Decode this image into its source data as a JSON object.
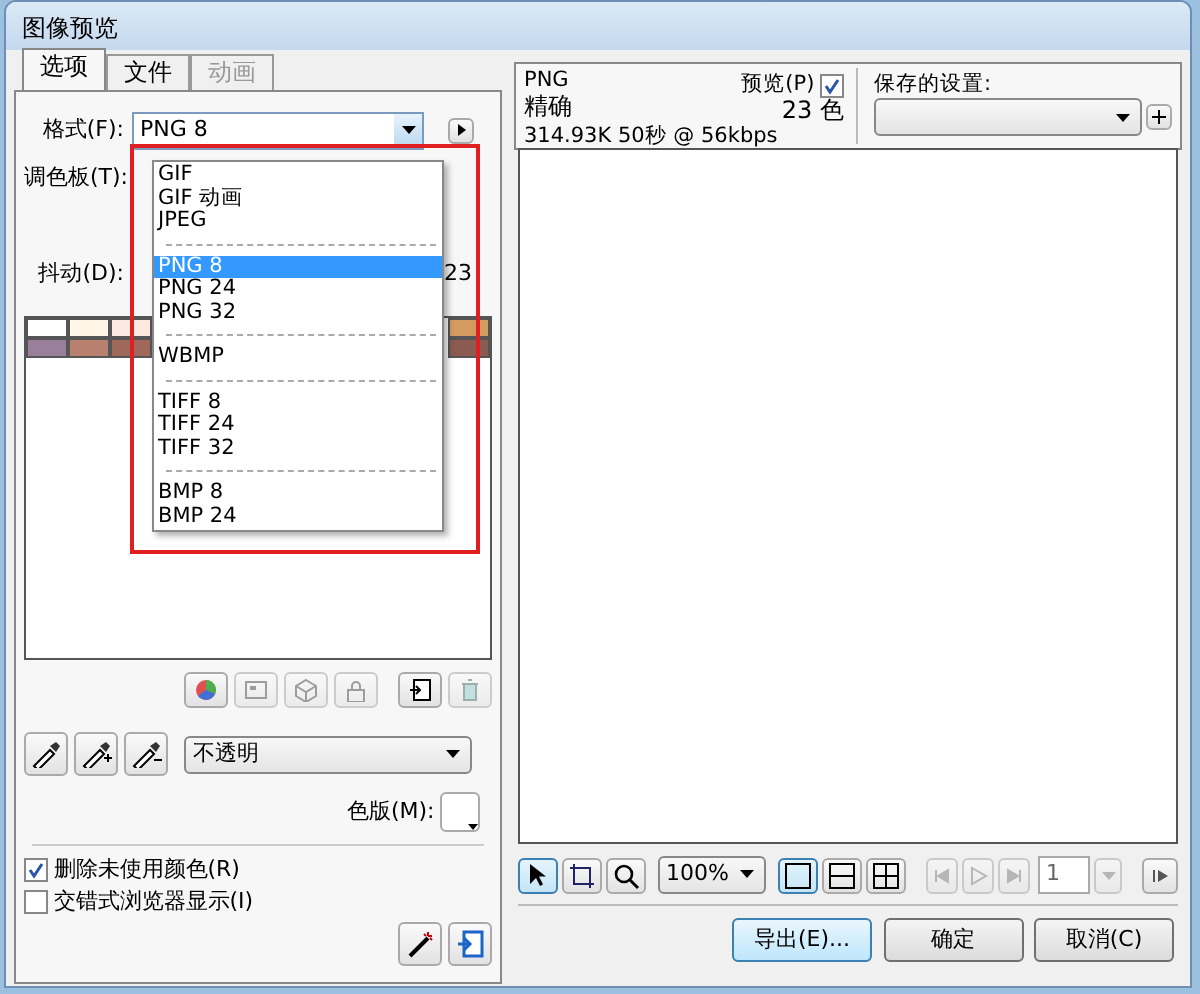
{
  "window": {
    "title": "图像预览"
  },
  "tabs": [
    {
      "label": "选项",
      "selected": true,
      "disabled": false
    },
    {
      "label": "文件",
      "selected": false,
      "disabled": false
    },
    {
      "label": "动画",
      "selected": false,
      "disabled": true
    }
  ],
  "format": {
    "label": "格式(F):",
    "value": "PNG 8"
  },
  "format_menu": {
    "groups": [
      [
        {
          "label": "GIF",
          "selected": false
        },
        {
          "label": "GIF 动画",
          "selected": false
        },
        {
          "label": "JPEG",
          "selected": false
        }
      ],
      [
        {
          "label": "PNG 8",
          "selected": true
        },
        {
          "label": "PNG 24",
          "selected": false
        },
        {
          "label": "PNG 32",
          "selected": false
        }
      ],
      [
        {
          "label": "WBMP",
          "selected": false
        }
      ],
      [
        {
          "label": "TIFF 8",
          "selected": false
        },
        {
          "label": "TIFF 24",
          "selected": false
        },
        {
          "label": "TIFF 32",
          "selected": false
        }
      ],
      [
        {
          "label": "BMP 8",
          "selected": false
        },
        {
          "label": "BMP 24",
          "selected": false
        }
      ]
    ]
  },
  "palette": {
    "label": "调色板(T):"
  },
  "dither": {
    "label": "抖动(D):",
    "colors": "23"
  },
  "swatches_left": [
    [
      {
        "color": "#ffffff"
      },
      {
        "color": "#fff6e8"
      },
      {
        "color": "#fbe9e2"
      }
    ],
    [
      {
        "color": "#9a7f9a"
      },
      {
        "color": "#b98070"
      },
      {
        "color": "#a0685a"
      }
    ]
  ],
  "swatches_right": [
    [
      {
        "color": "#d49a60"
      }
    ],
    [
      {
        "color": "#8b5a50"
      }
    ]
  ],
  "palette_tools": [
    {
      "kind": "wheel",
      "disabled": false
    },
    {
      "kind": "web",
      "disabled": true
    },
    {
      "kind": "cube",
      "disabled": true
    },
    {
      "kind": "lock",
      "disabled": true
    },
    {
      "kind": "add",
      "disabled": false
    },
    {
      "kind": "trash",
      "disabled": true
    }
  ],
  "eyedroppers": [
    {
      "kind": "plain"
    },
    {
      "kind": "plus"
    },
    {
      "kind": "minus"
    }
  ],
  "transparency": {
    "value": "不透明"
  },
  "matte": {
    "label": "色版(M):"
  },
  "options": [
    {
      "label": "删除未使用颜色(R)",
      "checked": true
    },
    {
      "label": "交错式浏览器显示(I)",
      "checked": false
    }
  ],
  "info": {
    "format": "PNG",
    "quality": "精确",
    "size": "314.93K  50秒 @ 56kbps",
    "preview_label": "预览(P)",
    "preview_checked": true,
    "colors": "23 色"
  },
  "saved_settings": {
    "label": "保存的设置:"
  },
  "tools": [
    {
      "kind": "pointer",
      "selected": true
    },
    {
      "kind": "crop",
      "selected": false
    },
    {
      "kind": "zoom",
      "selected": false
    }
  ],
  "zoom": {
    "value": "100%"
  },
  "views": [
    {
      "kind": "one",
      "selected": true
    },
    {
      "kind": "two",
      "selected": false
    },
    {
      "kind": "four",
      "selected": false
    }
  ],
  "frame": {
    "value": "1"
  },
  "buttons": [
    {
      "label": "导出(E)...",
      "default": true
    },
    {
      "label": "确定",
      "default": false
    },
    {
      "label": "取消(C)",
      "default": false
    }
  ]
}
